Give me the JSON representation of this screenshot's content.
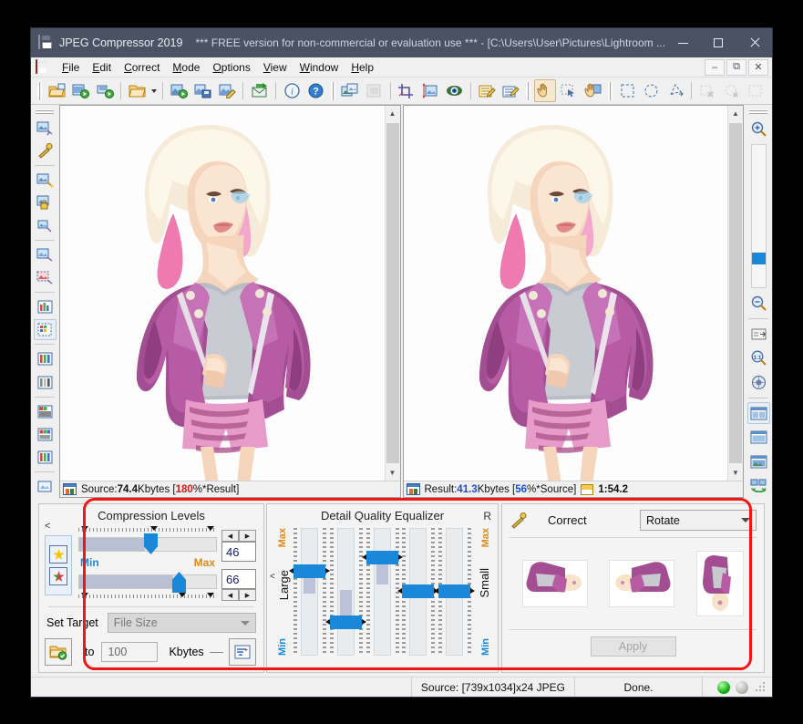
{
  "window": {
    "title": "JPEG Compressor 2019",
    "license_notice": "*** FREE version for non-commercial or evaluation use *** - [C:\\Users\\User\\Pictures\\Lightroom ...",
    "minimize": "—",
    "maximize": "□",
    "close": "✕",
    "app_icon": "floppy-disk-icon"
  },
  "menu": {
    "items": [
      {
        "label": "File",
        "accel": "F"
      },
      {
        "label": "Edit",
        "accel": "E"
      },
      {
        "label": "Correct",
        "accel": "C"
      },
      {
        "label": "Mode",
        "accel": "M"
      },
      {
        "label": "Options",
        "accel": "O"
      },
      {
        "label": "View",
        "accel": "V"
      },
      {
        "label": "Window",
        "accel": "W"
      },
      {
        "label": "Help",
        "accel": "H"
      }
    ],
    "mdi_controls": [
      "minimize",
      "restore",
      "close"
    ]
  },
  "toolbar": {
    "groups": [
      [
        "open-file-icon",
        "open-batch-icon",
        "process-folder-icon"
      ],
      [
        "open-folder-icon",
        "folder-dropdown-caret",
        "run-batch-icon"
      ],
      [
        "save-icon",
        "save-as-edit-icon"
      ],
      [
        "send-mail-icon"
      ],
      [
        "info-icon",
        "help-icon"
      ],
      [
        "compare-images-icon",
        "paste-image-icon"
      ],
      [
        "crop-icon",
        "resize-icon",
        "preview-eye-icon"
      ],
      [
        "edit-comment-icon",
        "edit-notes-icon"
      ],
      [
        "pan-hand-icon",
        "select-rect-icon",
        "grab-hand-icon"
      ],
      [
        "marquee-rect-icon",
        "marquee-ellipse-icon",
        "lasso-icon"
      ],
      [
        "deselect-icon",
        "invert-selection-icon",
        "selection-settings-icon"
      ]
    ]
  },
  "left_toolbar": {
    "items": [
      "image-tool-icon",
      "magic-wand-icon",
      "image-scale-icon",
      "image-lock-icon",
      "image-small-icon",
      "image-adjust-icon",
      "image-mask-icon",
      "histogram-icon",
      "color-table-icon",
      "rgb-channels-icon",
      "grayscale-channels-icon",
      "gradient-map-icon",
      "color-balance-icon",
      "levels-icon"
    ]
  },
  "right_toolbar": {
    "zoom_in": "zoom-in-icon",
    "zoom_slider": "zoom-slider",
    "zoom_out": "zoom-out-icon",
    "fit_window": "fit-window-icon",
    "actual_size": "one-to-one-icon",
    "navigator": "navigator-icon",
    "layout_items": [
      "split-view-icon",
      "single-view-icon",
      "result-view-icon",
      "swap-views-icon"
    ]
  },
  "panes": {
    "source": {
      "scrollbar": "vertical-scrollbar",
      "status_prefix": "Source: ",
      "size": "74.4",
      "size_unit": " Kbytes  [",
      "ratio": "180",
      "ratio_suffix": "%*Result]"
    },
    "result": {
      "scrollbar": "vertical-scrollbar",
      "status_prefix": "Result: ",
      "size": "41.3",
      "size_unit": " Kbytes  [",
      "ratio": "56",
      "ratio_suffix": "%*Source]",
      "time": "1:54.2"
    }
  },
  "compression": {
    "title": "Compression Levels",
    "collapse_chevron": "<",
    "min_label": "Min",
    "max_label": "Max",
    "slider_top_value": "46",
    "slider_bottom_value": "66",
    "spin_left": "◀",
    "spin_right": "▶",
    "mode_icons": [
      "luminance-quality-icon",
      "chrominance-quality-icon"
    ],
    "set_target_label": "Set Target",
    "target_type": "File Size",
    "to_label": "to",
    "target_value": "100",
    "unit_label": "Kbytes",
    "target_folder_icon": "target-folder-check-icon",
    "target_settings_icon": "target-settings-icon"
  },
  "equalizer": {
    "title": "Detail Quality Equalizer",
    "reset_label": "R",
    "collapse_chevron": "<",
    "left_label": "Large",
    "right_label": "Small",
    "max_label": "Max",
    "min_label": "Min",
    "slider_values": [
      62,
      22,
      78,
      50,
      50
    ]
  },
  "correct": {
    "wand_icon": "magic-wand-icon",
    "label": "Correct",
    "operation": "Rotate",
    "thumbnails": [
      "rotate-180-thumb",
      "rotate-flip-thumb",
      "rotate-90-thumb"
    ],
    "apply_label": "Apply"
  },
  "statusbar": {
    "source_info": "Source: [739x1034]x24 JPEG",
    "state": "Done.",
    "led_active": "green",
    "led_idle": "gray"
  },
  "colors": {
    "title_bar": "#4a5263",
    "accent_blue": "#1a87d8",
    "highlight_red": "#f31414",
    "min_label": "#1a87d8",
    "max_label": "#e08a15",
    "value_red": "#d41b1b",
    "value_blue": "#1a4fd0"
  }
}
